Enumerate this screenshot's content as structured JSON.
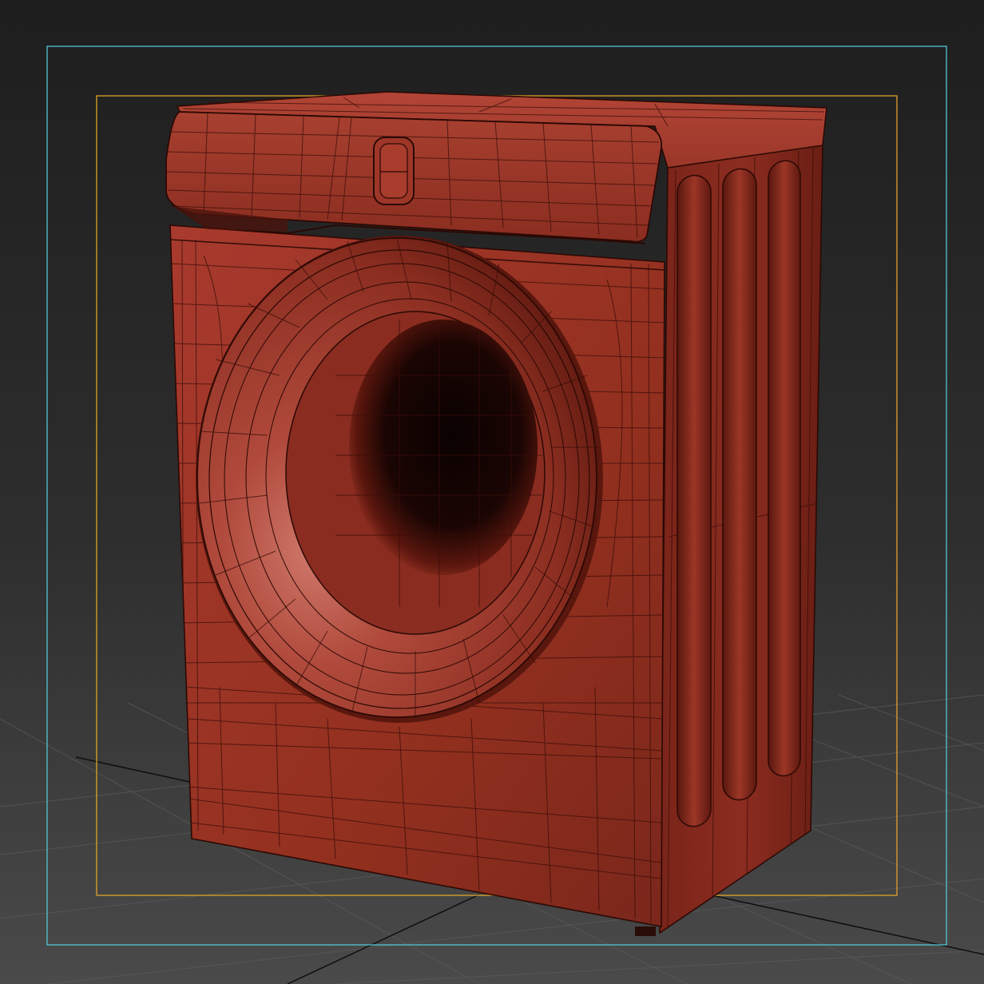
{
  "viewport": {
    "view": "perspective",
    "shading": "default-shading-with-wireframe",
    "background_top_color": "#1e1e1e",
    "background_bottom_color": "#4a4a4a",
    "grid_color": "#5c5c5c",
    "grid_axis_color": "#0e0e0e",
    "safe_frame_outer_color": "#4fc6d6",
    "safe_frame_inner_color": "#e0a32a"
  },
  "model": {
    "object": "washing-machine",
    "material_color": "#9a3327",
    "material_highlight_color": "#c25a4c",
    "material_shadow_color": "#4a120b",
    "wire_color": "#3a0d07",
    "drum_interior_color": "#0d0302"
  }
}
